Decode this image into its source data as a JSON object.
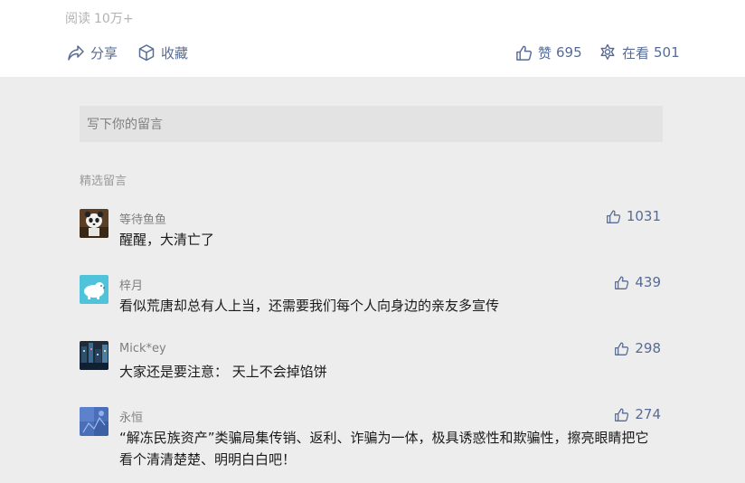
{
  "article": {
    "read_label": "阅读",
    "read_count": "10万+"
  },
  "toolbar": {
    "share_label": "分享",
    "favorite_label": "收藏",
    "like_label": "赞",
    "like_count": "695",
    "watch_label": "在看",
    "watch_count": "501"
  },
  "comment_input": {
    "placeholder": "写下你的留言"
  },
  "comments_section": {
    "title": "精选留言",
    "items": [
      {
        "nickname": "等待鱼鱼",
        "text": "醒醒，大清亡了",
        "likes": "1031",
        "avatar_icon": "panda-avatar"
      },
      {
        "nickname": "梓月",
        "text": "看似荒唐却总有人上当，还需要我们每个人向身边的亲友多宣传",
        "likes": "439",
        "avatar_icon": "polar-bear-avatar"
      },
      {
        "nickname": "Mick*ey",
        "text": "大家还是要注意： 天上不会掉馅饼",
        "likes": "298",
        "avatar_icon": "city-night-avatar"
      },
      {
        "nickname": "永恒",
        "text": "“解冻民族资产”类骗局集传销、返利、诈骗为一体，极具诱惑性和欺骗性，擦亮眼睛把它看个清清楚楚、明明白白吧！",
        "likes": "274",
        "avatar_icon": "blue-pattern-avatar"
      }
    ]
  },
  "colors": {
    "link_blue": "#576b95",
    "background": "#ededed"
  }
}
